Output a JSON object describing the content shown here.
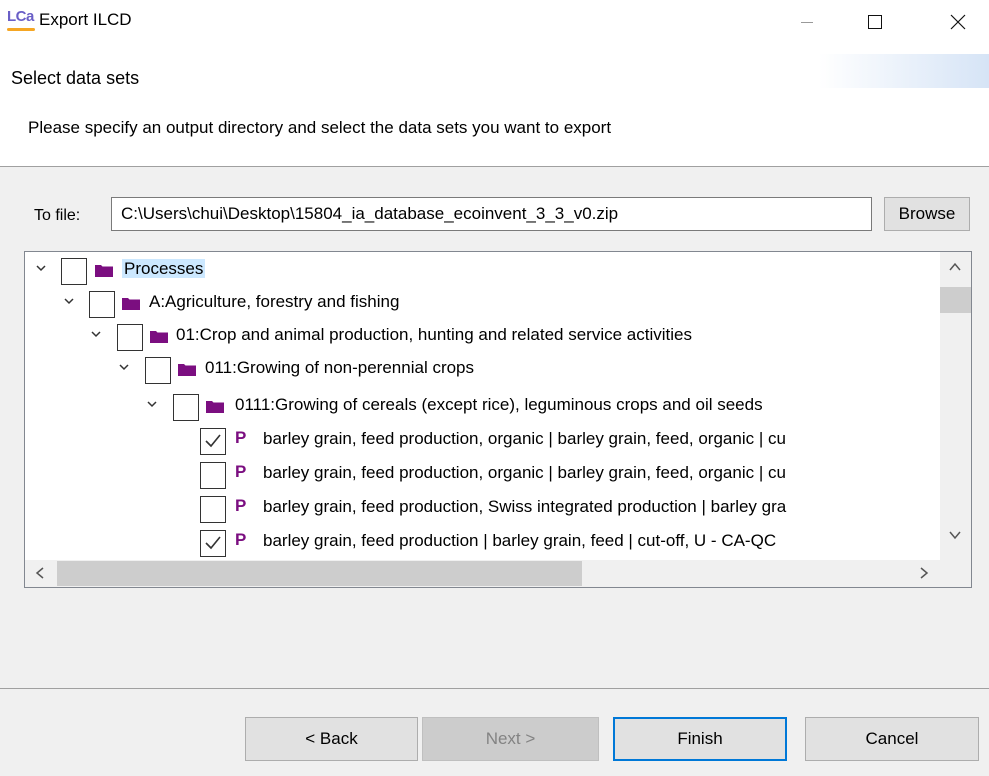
{
  "window": {
    "logo_text": "LCa",
    "title": "Export ILCD",
    "controls": [
      "minimize",
      "maximize",
      "close"
    ]
  },
  "header": {
    "title": "Select data sets",
    "description": "Please specify an output directory and select the data sets you want to export"
  },
  "file": {
    "label": "To file:",
    "value": "C:\\Users\\chui\\Desktop\\15804_ia_database_ecoinvent_3_3_v0.zip",
    "browse_label": "Browse"
  },
  "tree": {
    "rows": [
      {
        "label": "Processes",
        "type": "folder",
        "checked": false,
        "expanded": true,
        "selected": true
      },
      {
        "label": "A:Agriculture, forestry and fishing",
        "type": "folder",
        "checked": false,
        "expanded": true
      },
      {
        "label": "01:Crop and animal production, hunting and related service activities",
        "type": "folder",
        "checked": false,
        "expanded": true
      },
      {
        "label": "011:Growing of non-perennial crops",
        "type": "folder",
        "checked": false,
        "expanded": true
      },
      {
        "label": "0111:Growing of cereals (except rice), leguminous crops and oil seeds",
        "type": "folder",
        "checked": false,
        "expanded": true
      },
      {
        "label": "barley grain, feed production, organic | barley grain, feed, organic | cu",
        "type": "process",
        "tag": "P",
        "checked": true
      },
      {
        "label": "barley grain, feed production, organic | barley grain, feed, organic | cu",
        "type": "process",
        "tag": "P",
        "checked": false
      },
      {
        "label": "barley grain, feed production, Swiss integrated production | barley gra",
        "type": "process",
        "tag": "P",
        "checked": false
      },
      {
        "label": "barley grain, feed production | barley grain, feed | cut-off, U - CA-QC",
        "type": "process",
        "tag": "P",
        "checked": true
      }
    ]
  },
  "buttons": {
    "back": "< Back",
    "next": "Next >",
    "finish": "Finish",
    "cancel": "Cancel"
  },
  "colors": {
    "folder": "#7b0e80",
    "process_tag": "#7b0e80",
    "selection": "#cce8ff",
    "default_button_border": "#0078d7"
  }
}
